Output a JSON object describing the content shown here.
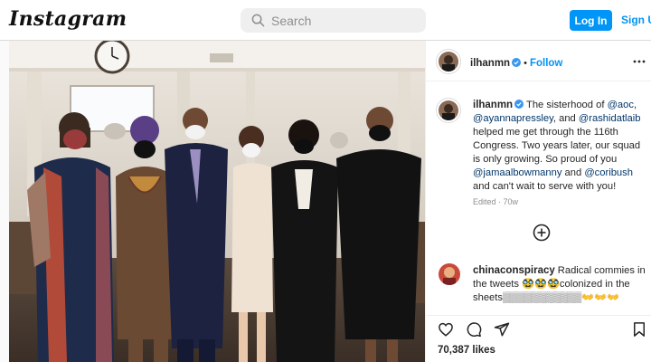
{
  "header": {
    "logo": "Instagram",
    "search_placeholder": "Search",
    "login_label": "Log In",
    "signup_label": "Sign Up"
  },
  "post": {
    "username": "ilhanmn",
    "follow_label": "Follow",
    "caption_lines": [
      "The sisterhood of ",
      "@aoc",
      ", ",
      "@ayannapressley",
      ", and ",
      "@rashidatlaib",
      " helped me get through the 116th Congress. Two years later, our squad is only growing. So proud of you ",
      "@jamaalbowmanny",
      " and ",
      "@coribush",
      " and can't wait to serve with you!"
    ],
    "edited_label": "Edited",
    "age": "70w",
    "likes": "70,387 likes"
  },
  "comment": {
    "username": "chinaconspiracy",
    "text": "Radical commies in the tweets 🥸🥸🥸colonized in the sheets",
    "text_part1": "Radical commies in the tweets ",
    "emoji1": "🥸🥸🥸",
    "text_part2": "colonized in the sheets",
    "emoji2": "▒▒▒▒▒▒▒▒▒▒▒👐👐👐"
  },
  "icons": {
    "search": "search-icon",
    "verified": "verified-badge-icon",
    "more": "more-options-icon",
    "add": "add-circle-icon",
    "like": "heart-icon",
    "comment": "comment-icon",
    "share": "send-icon",
    "save": "bookmark-icon"
  },
  "colors": {
    "accent": "#0095f6",
    "mention": "#00376b",
    "muted": "#8e8e8e"
  }
}
